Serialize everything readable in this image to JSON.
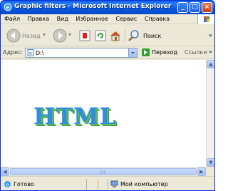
{
  "window": {
    "title": "Graphic filters - Microsoft Internet Explorer"
  },
  "menu": [
    "Файл",
    "Правка",
    "Вид",
    "Избранное",
    "Сервис",
    "Справка"
  ],
  "toolbar": {
    "back_label": "Назад",
    "search_label": "Поиск"
  },
  "address": {
    "label": "Адрес:",
    "value": "D:\\",
    "go_label": "Переход",
    "links_label": "Ссылки"
  },
  "content": {
    "heading": "HTML"
  },
  "status": {
    "left_text": "Готово",
    "zone_text": "Мой компьютер"
  },
  "colors": {
    "titlebar": "#0a5fe8",
    "html_text": "#2f8ee0",
    "html_shadow": "#60b85a"
  }
}
